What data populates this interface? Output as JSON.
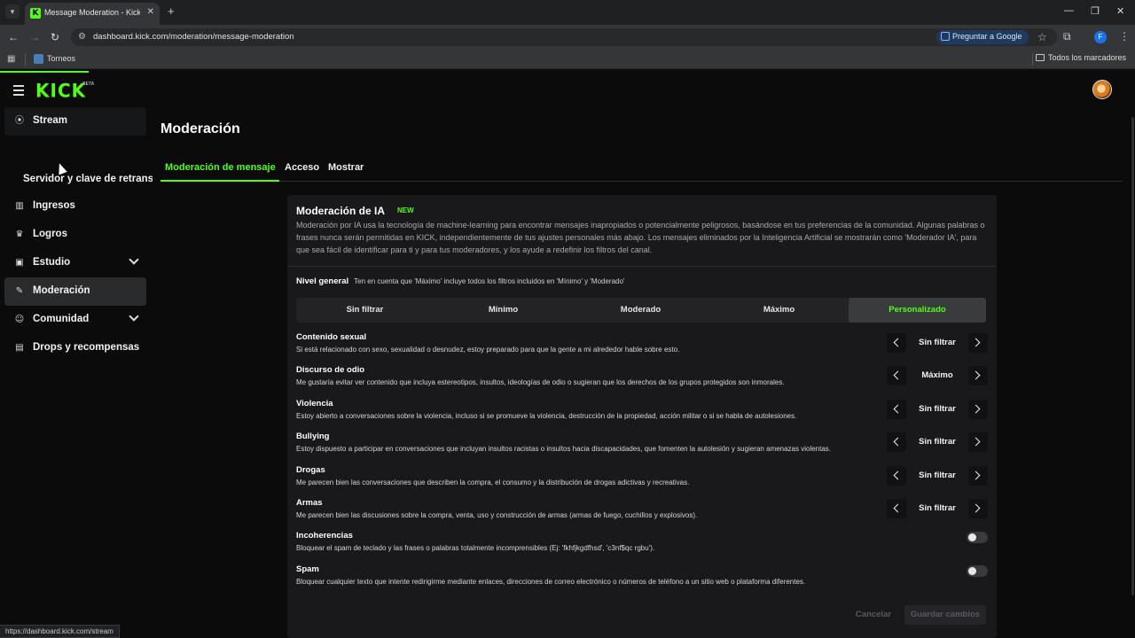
{
  "browser": {
    "tab_title": "Message Moderation - Kick Da",
    "url": "dashboard.kick.com/moderation/message-moderation",
    "google_button": "Preguntar a Google",
    "profile_initial": "F",
    "bookmark": "Torneos",
    "bookmarks_all": "Todos los marcadores",
    "status_url": "https://dashboard.kick.com/stream"
  },
  "brand": {
    "logo": "KICK",
    "beta": "BETA",
    "accent": "#53fc18"
  },
  "sidebar": {
    "items": [
      {
        "label": "Stream",
        "icon": "broadcast-icon"
      },
      {
        "label": "Ingresos",
        "icon": "chart-icon"
      },
      {
        "label": "Logros",
        "icon": "trophy-icon"
      },
      {
        "label": "Estudio",
        "icon": "studio-icon"
      },
      {
        "label": "Moderación",
        "icon": "wrench-icon"
      },
      {
        "label": "Comunidad",
        "icon": "people-icon"
      },
      {
        "label": "Drops y recompensas",
        "icon": "drops-icon"
      }
    ],
    "sub_item": "Servidor y clave de retransmisión"
  },
  "page": {
    "title": "Moderación",
    "tabs": [
      "Moderación de mensaje",
      "Acceso",
      "Mostrar"
    ]
  },
  "ai": {
    "title": "Moderación de IA",
    "badge": "NEW",
    "description": "Moderación por IA usa la tecnología de machine-learning para encontrar mensajes inapropiados o potencialmente peligrosos, basándose en tus preferencias de la comunidad. Algunas palabras o frases nunca serán permitidas en KICK, independientemente de tus ajustes personales más abajo. Los mensajes eliminados por la Inteligencia Artificial se mostrarán como 'Moderador IA', para que sea fácil de identificar para ti y para tus moderadores, y los ayude a redefinir los filtros del canal.",
    "level_label": "Nivel general",
    "level_note": "Ten en cuenta que 'Máximo' incluye todos los filtros incluidos en 'Mínimo' y 'Moderado'",
    "levels": [
      "Sin filtrar",
      "Mínimo",
      "Moderado",
      "Máximo",
      "Personalizado"
    ],
    "selected_level": "Personalizado",
    "categories": [
      {
        "title": "Contenido sexual",
        "desc": "Si está relacionado con sexo, sexualidad o desnudez, estoy preparado para que la gente a mi alrededor hable sobre esto.",
        "value": "Sin filtrar"
      },
      {
        "title": "Discurso de odio",
        "desc": "Me gustaría evitar ver contenido que incluya estereotipos, insultos, ideologías de odio o sugieran que los derechos de los grupos protegidos son inmorales.",
        "value": "Máximo"
      },
      {
        "title": "Violencia",
        "desc": "Estoy abierto a conversaciones sobre la violencia, incluso si se promueve la violencia, destrucción de la propiedad, acción militar o si se habla de autolesiones.",
        "value": "Sin filtrar"
      },
      {
        "title": "Bullying",
        "desc": "Estoy dispuesto a participar en conversaciones que incluyan insultos racistas o insultos hacia discapacidades, que fomenten la autolesión y sugieran amenazas violentas.",
        "value": "Sin filtrar"
      },
      {
        "title": "Drogas",
        "desc": "Me parecen bien las conversaciones que describen la compra, el consumo y la distribución de drogas adictivas y recreativas.",
        "value": "Sin filtrar"
      },
      {
        "title": "Armas",
        "desc": "Me parecen bien las discusiones sobre la compra, venta, uso y construcción de armas (armas de fuego, cuchillos y explosivos).",
        "value": "Sin filtrar"
      }
    ],
    "toggles": [
      {
        "title": "Incoherencias",
        "desc": "Bloquear el spam de teclado y las frases o palabras totalmente incomprensibles (Ej: 'fkhfjkgdfhsd', 'c3nf$qc rgbu').",
        "on": false
      },
      {
        "title": "Spam",
        "desc": "Bloquear cualquier texto que intente redirigirme mediante enlaces, direcciones de correo electrónico o números de teléfono a un sitio web o plataforma diferentes.",
        "on": false
      }
    ],
    "cancel_label": "Cancelar",
    "save_label": "Guardar cambios"
  }
}
